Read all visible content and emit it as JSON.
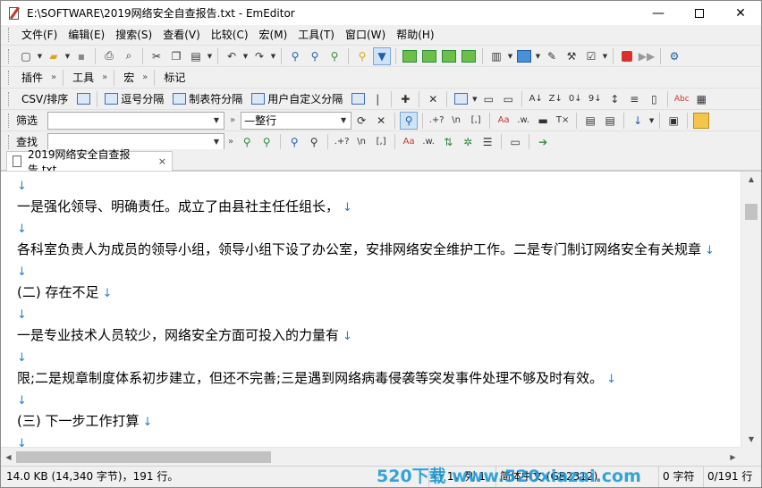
{
  "window": {
    "title": "E:\\SOFTWARE\\2019网络安全自查报告.txt - EmEditor",
    "controls": {
      "minimize": "—",
      "maximize": "",
      "close": "✕"
    }
  },
  "menu": {
    "items": [
      "文件(F)",
      "编辑(E)",
      "搜索(S)",
      "查看(V)",
      "比较(C)",
      "宏(M)",
      "工具(T)",
      "窗口(W)",
      "帮助(H)"
    ]
  },
  "toolbar2": {
    "plugins_label": "插件",
    "tools_label": "工具",
    "macro_label": "宏",
    "bookmark_label": "标记"
  },
  "toolbar3": {
    "csv_label": "CSV/排序",
    "comma_label": "逗号分隔",
    "tab_label": "制表符分隔",
    "user_label": "用户自定义分隔"
  },
  "filterbar": {
    "label": "筛选",
    "input_value": "",
    "mode_value": "—整行"
  },
  "findbar": {
    "label": "查找",
    "input_value": ""
  },
  "tab": {
    "label": "2019网络安全自查报告.txt",
    "close": "×"
  },
  "editor": {
    "newline_mark": "↓",
    "lines": [
      "",
      "一是强化领导、明确责任。成立了由县社主任任组长，",
      "",
      "各科室负责人为成员的领导小组，领导小组下设了办公室，安排网络安全维护工作。二是专门制订网络安全有关规章",
      "",
      "(二) 存在不足",
      "",
      "一是专业技术人员较少，网络安全方面可投入的力量有",
      "",
      "限;二是规章制度体系初步建立，但还不完善;三是遇到网络病毒侵袭等突发事件处理不够及时有效。",
      "",
      "(三) 下一步工作打算",
      ""
    ]
  },
  "status": {
    "size": "14.0 KB (14,340 字节)，191 行。",
    "position": "行 1，列 1",
    "encoding": "简体中文 (GB2312)",
    "chars": "0 字符",
    "line_count": "0/191 行"
  },
  "watermark": {
    "text": "520下载  www.520xiazai.com"
  },
  "colors": {
    "newline": "#2a7fd4",
    "watermark": "#1f9bd7"
  }
}
